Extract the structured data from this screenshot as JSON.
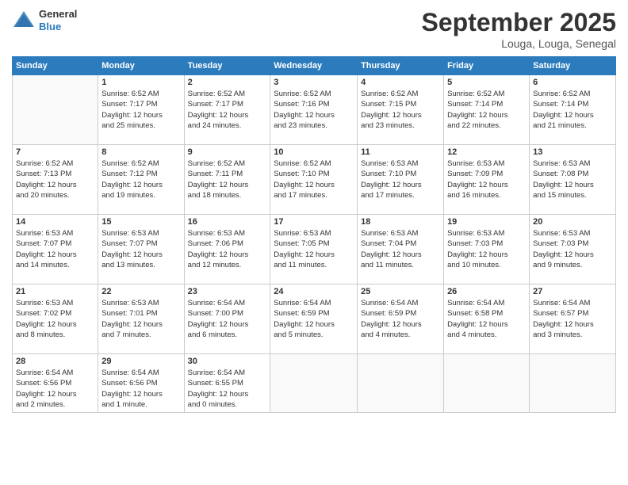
{
  "header": {
    "logo_general": "General",
    "logo_blue": "Blue",
    "month_title": "September 2025",
    "location": "Louga, Louga, Senegal"
  },
  "days_of_week": [
    "Sunday",
    "Monday",
    "Tuesday",
    "Wednesday",
    "Thursday",
    "Friday",
    "Saturday"
  ],
  "weeks": [
    [
      {
        "day": "",
        "info": ""
      },
      {
        "day": "1",
        "info": "Sunrise: 6:52 AM\nSunset: 7:17 PM\nDaylight: 12 hours\nand 25 minutes."
      },
      {
        "day": "2",
        "info": "Sunrise: 6:52 AM\nSunset: 7:17 PM\nDaylight: 12 hours\nand 24 minutes."
      },
      {
        "day": "3",
        "info": "Sunrise: 6:52 AM\nSunset: 7:16 PM\nDaylight: 12 hours\nand 23 minutes."
      },
      {
        "day": "4",
        "info": "Sunrise: 6:52 AM\nSunset: 7:15 PM\nDaylight: 12 hours\nand 23 minutes."
      },
      {
        "day": "5",
        "info": "Sunrise: 6:52 AM\nSunset: 7:14 PM\nDaylight: 12 hours\nand 22 minutes."
      },
      {
        "day": "6",
        "info": "Sunrise: 6:52 AM\nSunset: 7:14 PM\nDaylight: 12 hours\nand 21 minutes."
      }
    ],
    [
      {
        "day": "7",
        "info": "Sunrise: 6:52 AM\nSunset: 7:13 PM\nDaylight: 12 hours\nand 20 minutes."
      },
      {
        "day": "8",
        "info": "Sunrise: 6:52 AM\nSunset: 7:12 PM\nDaylight: 12 hours\nand 19 minutes."
      },
      {
        "day": "9",
        "info": "Sunrise: 6:52 AM\nSunset: 7:11 PM\nDaylight: 12 hours\nand 18 minutes."
      },
      {
        "day": "10",
        "info": "Sunrise: 6:52 AM\nSunset: 7:10 PM\nDaylight: 12 hours\nand 17 minutes."
      },
      {
        "day": "11",
        "info": "Sunrise: 6:53 AM\nSunset: 7:10 PM\nDaylight: 12 hours\nand 17 minutes."
      },
      {
        "day": "12",
        "info": "Sunrise: 6:53 AM\nSunset: 7:09 PM\nDaylight: 12 hours\nand 16 minutes."
      },
      {
        "day": "13",
        "info": "Sunrise: 6:53 AM\nSunset: 7:08 PM\nDaylight: 12 hours\nand 15 minutes."
      }
    ],
    [
      {
        "day": "14",
        "info": "Sunrise: 6:53 AM\nSunset: 7:07 PM\nDaylight: 12 hours\nand 14 minutes."
      },
      {
        "day": "15",
        "info": "Sunrise: 6:53 AM\nSunset: 7:07 PM\nDaylight: 12 hours\nand 13 minutes."
      },
      {
        "day": "16",
        "info": "Sunrise: 6:53 AM\nSunset: 7:06 PM\nDaylight: 12 hours\nand 12 minutes."
      },
      {
        "day": "17",
        "info": "Sunrise: 6:53 AM\nSunset: 7:05 PM\nDaylight: 12 hours\nand 11 minutes."
      },
      {
        "day": "18",
        "info": "Sunrise: 6:53 AM\nSunset: 7:04 PM\nDaylight: 12 hours\nand 11 minutes."
      },
      {
        "day": "19",
        "info": "Sunrise: 6:53 AM\nSunset: 7:03 PM\nDaylight: 12 hours\nand 10 minutes."
      },
      {
        "day": "20",
        "info": "Sunrise: 6:53 AM\nSunset: 7:03 PM\nDaylight: 12 hours\nand 9 minutes."
      }
    ],
    [
      {
        "day": "21",
        "info": "Sunrise: 6:53 AM\nSunset: 7:02 PM\nDaylight: 12 hours\nand 8 minutes."
      },
      {
        "day": "22",
        "info": "Sunrise: 6:53 AM\nSunset: 7:01 PM\nDaylight: 12 hours\nand 7 minutes."
      },
      {
        "day": "23",
        "info": "Sunrise: 6:54 AM\nSunset: 7:00 PM\nDaylight: 12 hours\nand 6 minutes."
      },
      {
        "day": "24",
        "info": "Sunrise: 6:54 AM\nSunset: 6:59 PM\nDaylight: 12 hours\nand 5 minutes."
      },
      {
        "day": "25",
        "info": "Sunrise: 6:54 AM\nSunset: 6:59 PM\nDaylight: 12 hours\nand 4 minutes."
      },
      {
        "day": "26",
        "info": "Sunrise: 6:54 AM\nSunset: 6:58 PM\nDaylight: 12 hours\nand 4 minutes."
      },
      {
        "day": "27",
        "info": "Sunrise: 6:54 AM\nSunset: 6:57 PM\nDaylight: 12 hours\nand 3 minutes."
      }
    ],
    [
      {
        "day": "28",
        "info": "Sunrise: 6:54 AM\nSunset: 6:56 PM\nDaylight: 12 hours\nand 2 minutes."
      },
      {
        "day": "29",
        "info": "Sunrise: 6:54 AM\nSunset: 6:56 PM\nDaylight: 12 hours\nand 1 minute."
      },
      {
        "day": "30",
        "info": "Sunrise: 6:54 AM\nSunset: 6:55 PM\nDaylight: 12 hours\nand 0 minutes."
      },
      {
        "day": "",
        "info": ""
      },
      {
        "day": "",
        "info": ""
      },
      {
        "day": "",
        "info": ""
      },
      {
        "day": "",
        "info": ""
      }
    ]
  ]
}
